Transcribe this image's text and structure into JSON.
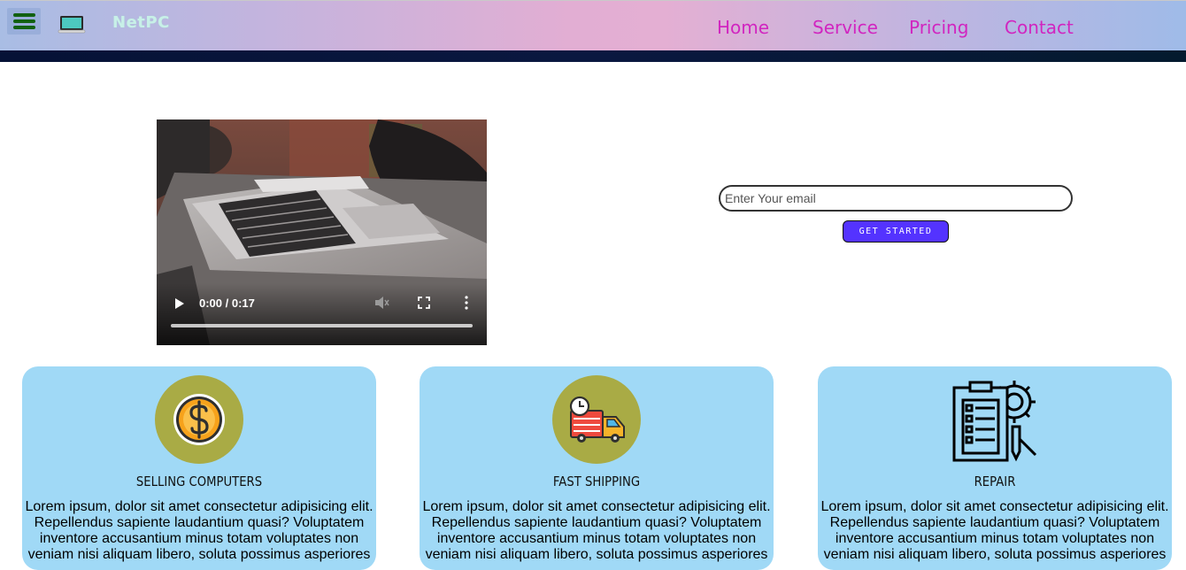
{
  "navbar": {
    "brand": "NetPC",
    "links": [
      "Home",
      "Service",
      "Pricing",
      "Contact"
    ]
  },
  "video": {
    "time_display": "0:00 / 0:17",
    "progress": 0
  },
  "signup": {
    "email_placeholder": "Enter Your email",
    "button_label": "GET STARTED"
  },
  "cards": [
    {
      "title": "SELLING COMPUTERS",
      "icon": "dollar-coin-icon",
      "text": "Lorem ipsum, dolor sit amet consectetur adipisicing elit. Repellendus sapiente laudantium quasi? Voluptatem inventore accusantium minus totam voluptates non veniam nisi aliquam libero, soluta possimus asperiores"
    },
    {
      "title": "FAST SHIPPING",
      "icon": "delivery-truck-icon",
      "text": "Lorem ipsum, dolor sit amet consectetur adipisicing elit. Repellendus sapiente laudantium quasi? Voluptatem inventore accusantium minus totam voluptates non veniam nisi aliquam libero, soluta possimus asperiores"
    },
    {
      "title": "REPAIR",
      "icon": "repair-checklist-gear-icon",
      "text": "Lorem ipsum, dolor sit amet consectetur adipisicing elit. Repellendus sapiente laudantium quasi? Voluptatem inventore accusantium minus totam voluptates non veniam nisi aliquam libero, soluta possimus asperiores"
    }
  ],
  "colors": {
    "nav_link": "#d125c0",
    "card_bg": "#a0d9f6",
    "button_bg": "#5433ff",
    "icon_circle": "#a9ab45"
  }
}
